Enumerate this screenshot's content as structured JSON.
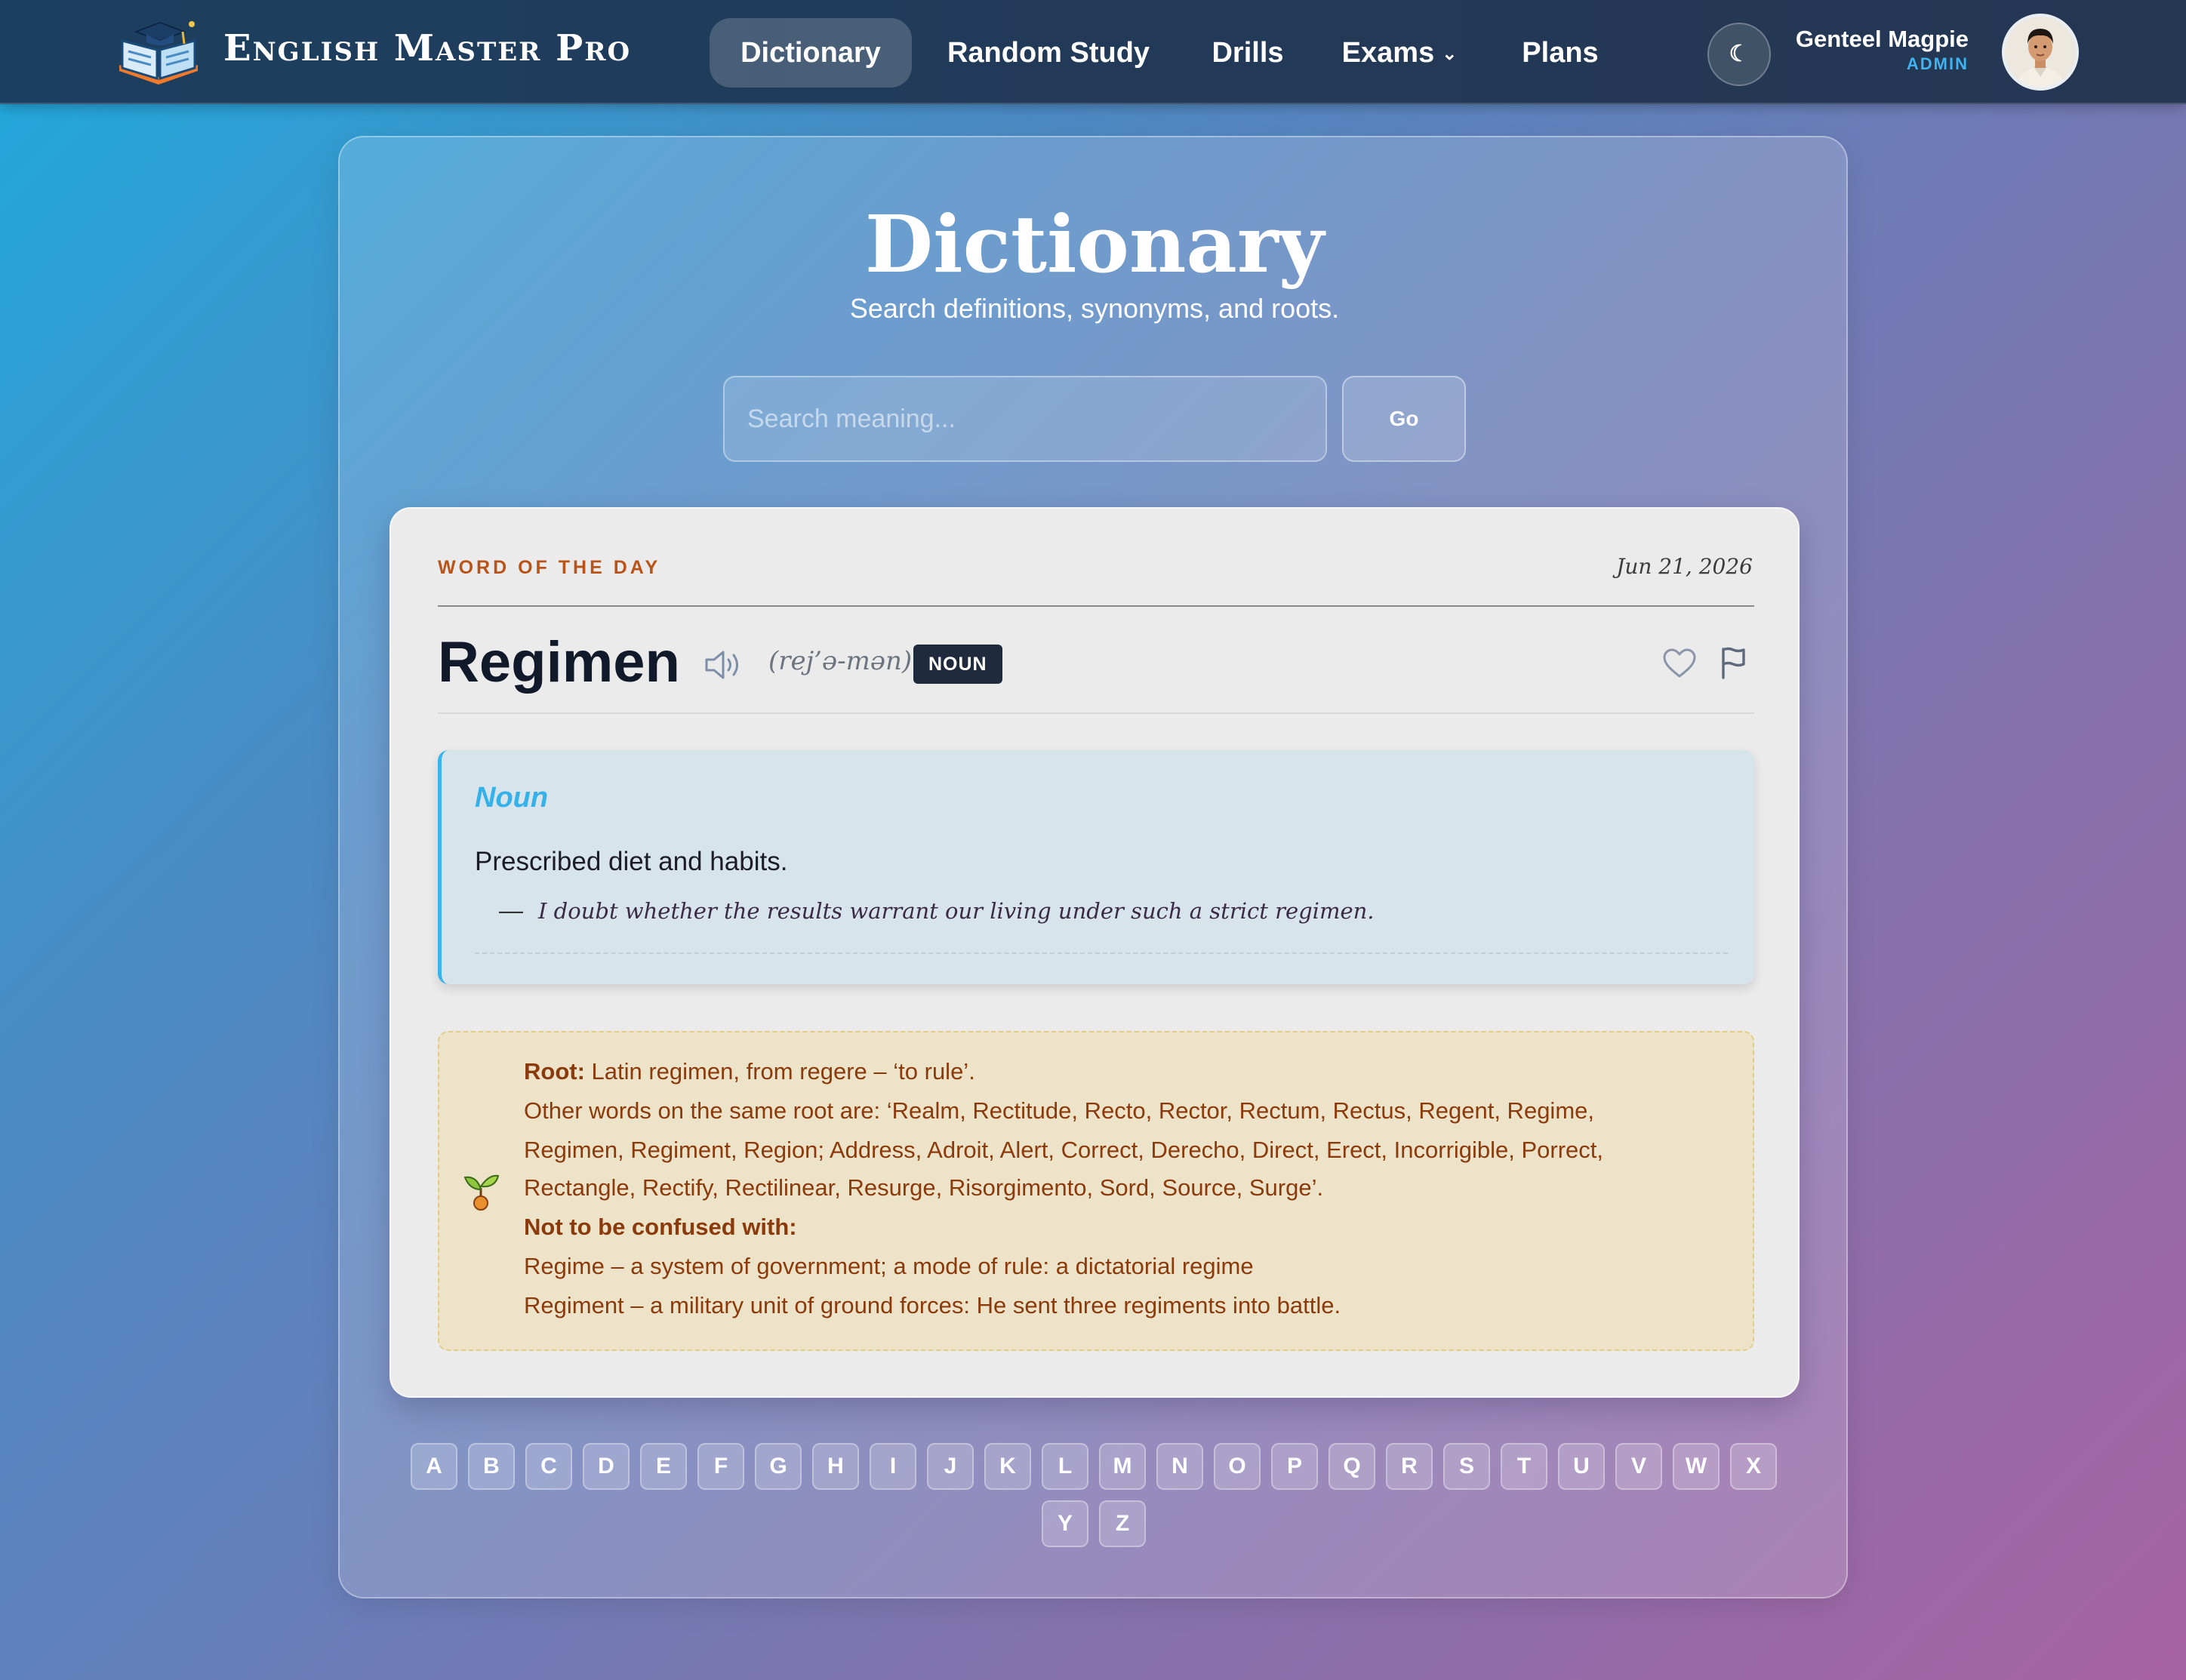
{
  "brand": {
    "title": "English Master Pro"
  },
  "nav": {
    "items": [
      {
        "label": "Dictionary"
      },
      {
        "label": "Random Study"
      },
      {
        "label": "Drills"
      },
      {
        "label": "Exams"
      },
      {
        "label": "Plans"
      }
    ],
    "active": "Dictionary"
  },
  "user": {
    "name": "Genteel Magpie",
    "role": "ADMIN"
  },
  "page": {
    "title": "Dictionary",
    "subtitle": "Search definitions, synonyms, and roots."
  },
  "search": {
    "placeholder": "Search meaning...",
    "value": "",
    "button_label": "Go"
  },
  "word_of_day": {
    "label": "WORD OF THE DAY",
    "date": "Jun 21, 2026",
    "word": "Regimen",
    "pronunciation": "(rej’ə-mən)",
    "part_of_speech": "NOUN",
    "definition": {
      "pos": "Noun",
      "text": "Prescribed diet and habits.",
      "dash": "—",
      "example": "I doubt whether the results warrant our living under such a strict regimen."
    },
    "root": {
      "label": "Root:",
      "text": " Latin regimen, from regere – ‘to rule’.",
      "related_lines": [
        "Other words on the same root are: ‘Realm, Rectitude, Recto, Rector, Rectum, Rectus, Regent, Regime,",
        "Regimen, Regiment, Region; Address, Adroit, Alert, Correct, Derecho, Direct, Erect, Incorrigible, Porrect,",
        "Rectangle, Rectify, Rectilinear, Resurge, Risorgimento, Sord, Source, Surge’."
      ],
      "confuse_label": "Not to be confused with:",
      "confuse_items": [
        "Regime – a system of government; a mode of rule: a dictatorial regime",
        "Regiment – a military unit of ground forces: He sent three regiments into battle."
      ]
    }
  },
  "alphabet": [
    "A",
    "B",
    "C",
    "D",
    "E",
    "F",
    "G",
    "H",
    "I",
    "J",
    "K",
    "L",
    "M",
    "N",
    "O",
    "P",
    "Q",
    "R",
    "S",
    "T",
    "U",
    "V",
    "W",
    "X",
    "Y",
    "Z"
  ],
  "icons": {
    "logo": "book-graduation-cap-icon",
    "theme": "moon-icon",
    "speaker": "speaker-icon",
    "favorite": "heart-icon",
    "report": "flag-icon",
    "root": "sprout-icon"
  },
  "colors": {
    "accent": "#38b3ec",
    "wotd_label": "#b8541a",
    "root_text": "#8b3a0c",
    "badge": "#1f2b3c"
  }
}
